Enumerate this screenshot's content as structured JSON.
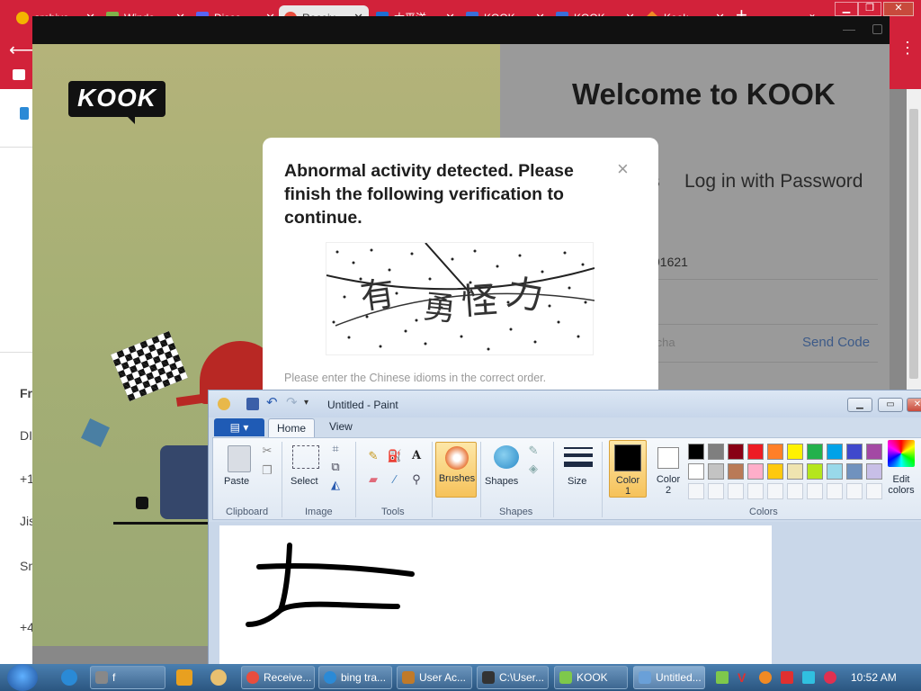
{
  "browser": {
    "tabs": [
      {
        "label": "archive",
        "color": "#f4b400",
        "active": false
      },
      {
        "label": "Windo",
        "color": "#7fb24a",
        "active": false
      },
      {
        "label": "Disco",
        "color": "#5865f2",
        "active": false
      },
      {
        "label": "Receiv",
        "color": "#e84d3d",
        "active": true
      },
      {
        "label": "太平洋",
        "color": "#1f6fd1",
        "active": false
      },
      {
        "label": "KOOK",
        "color": "#3b6fd8",
        "active": false
      },
      {
        "label": "KOOK",
        "color": "#3b6fd8",
        "active": false
      },
      {
        "label": "Kook",
        "color": "#f08a24",
        "active": false
      }
    ],
    "new_tab": "+",
    "tab_menu": "⌄"
  },
  "background_page": {
    "items": [
      "Fr",
      "DI",
      "+1",
      "Jis",
      "Sn",
      "+4"
    ]
  },
  "kook": {
    "logo": "KOOK",
    "welcome": "Welcome to KOOK",
    "login_tab_partial": "s",
    "login_password_tab": "Log in with Password",
    "phone_value": "91621",
    "captcha_placeholder": "tcha",
    "send_code": "Send Code"
  },
  "captcha_modal": {
    "title": "Abnormal activity detected. Please finish the following verification to continue.",
    "close": "×",
    "captcha_chars": [
      "有",
      "勇",
      "怪",
      "力"
    ],
    "hint": "Please enter the Chinese idioms in the correct order."
  },
  "paint": {
    "title": "Untitled - Paint",
    "tabs": {
      "home": "Home",
      "view": "View"
    },
    "clipboard": {
      "paste": "Paste",
      "group": "Clipboard"
    },
    "image": {
      "select": "Select",
      "group": "Image"
    },
    "tools": {
      "group": "Tools"
    },
    "brushes": "Brushes",
    "shapes": {
      "label": "Shapes",
      "group": "Shapes"
    },
    "size": "Size",
    "color1": {
      "line1": "Color",
      "line2": "1"
    },
    "color2": {
      "line1": "Color",
      "line2": "2"
    },
    "colors_group": "Colors",
    "edit_colors": {
      "line1": "Edit",
      "line2": "colors"
    },
    "palette_row1": [
      "#000000",
      "#7f7f7f",
      "#880015",
      "#ed1c24",
      "#ff7f27",
      "#fff200",
      "#22b14c",
      "#00a2e8",
      "#3f48cc",
      "#a349a4"
    ],
    "palette_row2": [
      "#ffffff",
      "#c3c3c3",
      "#b97a57",
      "#ffaec9",
      "#ffc90e",
      "#efe4b0",
      "#b5e61d",
      "#99d9ea",
      "#7092be",
      "#c8bfe7"
    ]
  },
  "taskbar": {
    "items": [
      {
        "label": "f",
        "color": "#888"
      },
      {
        "label": "Receive...",
        "color": "#e84d3d"
      },
      {
        "label": "bing tra...",
        "color": "#2b8ad6"
      },
      {
        "label": "User Ac...",
        "color": "#c07a2a"
      },
      {
        "label": "C:\\User...",
        "color": "#333"
      },
      {
        "label": "KOOK",
        "color": "#7ec84b"
      },
      {
        "label": "Untitled...",
        "color": "#6aa0d8"
      }
    ],
    "time": "10:52 AM"
  }
}
